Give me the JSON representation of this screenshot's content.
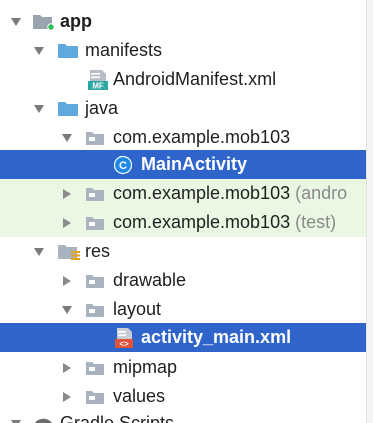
{
  "tree": {
    "items": [
      {
        "label": "app",
        "expanded": true,
        "icon": "module-folder-icon"
      },
      {
        "label": "manifests",
        "expanded": true,
        "icon": "folder-icon"
      },
      {
        "label": "AndroidManifest.xml",
        "icon": "manifest-file-icon",
        "icon_text": "MF"
      },
      {
        "label": "java",
        "expanded": true,
        "icon": "source-folder-icon"
      },
      {
        "label": "com.example.mob103",
        "expanded": true,
        "icon": "package-icon"
      },
      {
        "label": "MainActivity",
        "icon": "class-icon",
        "icon_text": "C",
        "selected": true
      },
      {
        "label": "com.example.mob103",
        "suffix": "(andro",
        "expanded": false,
        "icon": "package-icon"
      },
      {
        "label": "com.example.mob103",
        "suffix": "(test)",
        "expanded": false,
        "icon": "package-icon"
      },
      {
        "label": "res",
        "expanded": true,
        "icon": "resource-folder-icon"
      },
      {
        "label": "drawable",
        "expanded": false,
        "icon": "folder-icon"
      },
      {
        "label": "layout",
        "expanded": true,
        "icon": "folder-icon"
      },
      {
        "label": "activity_main.xml",
        "icon": "layout-file-icon",
        "icon_text": "<>",
        "selected": true
      },
      {
        "label": "mipmap",
        "expanded": false,
        "icon": "folder-icon"
      },
      {
        "label": "values",
        "expanded": false,
        "icon": "folder-icon"
      },
      {
        "label": "Gradle Scripts",
        "expanded": true,
        "icon": "gradle-icon"
      }
    ]
  },
  "colors": {
    "selection": "#2f65ca",
    "test_row": "#eaf7e2",
    "folder": "#5ea9dd",
    "package": "#a9b3bf",
    "class_badge": "#1e88e5",
    "text": "#1f1f1f",
    "muted": "#8a8a8a"
  }
}
